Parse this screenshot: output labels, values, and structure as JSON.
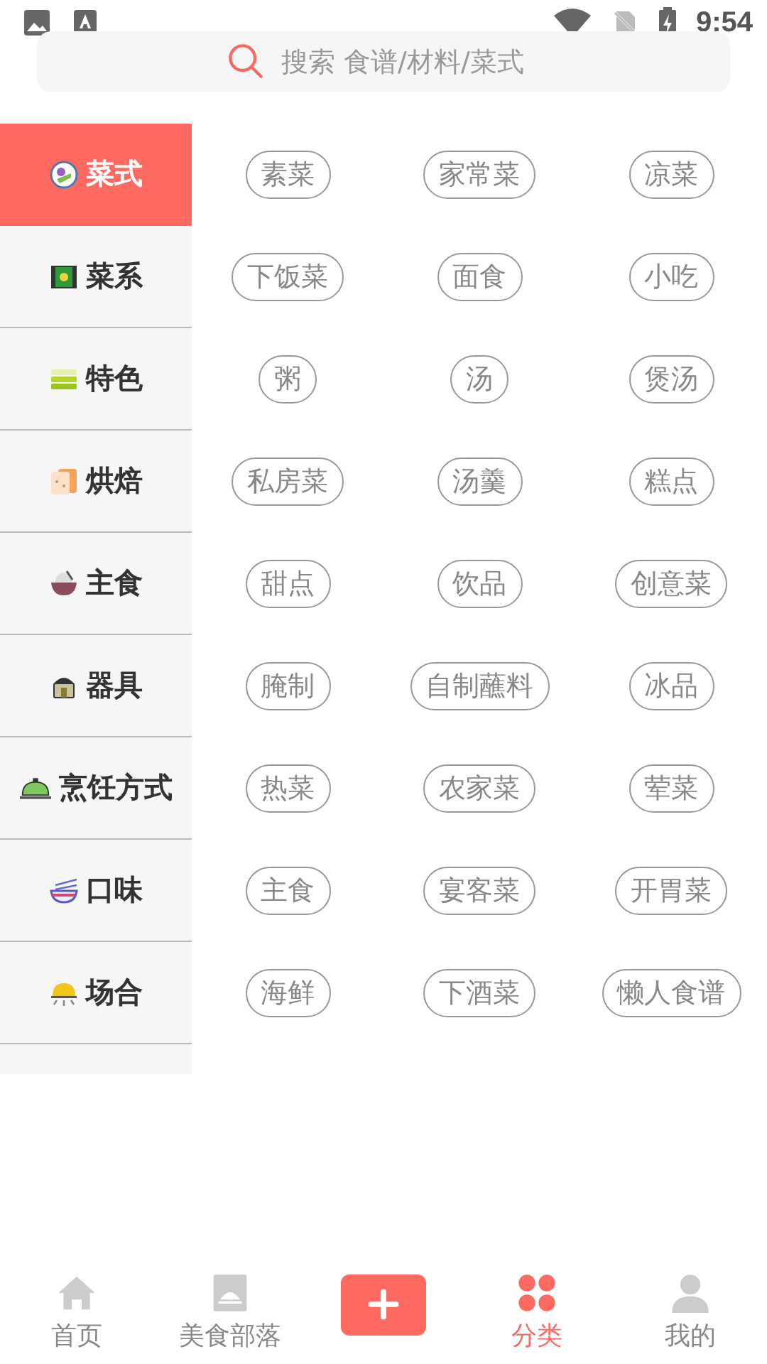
{
  "status_bar": {
    "time": "9:54"
  },
  "search": {
    "placeholder": "搜索 食谱/材料/菜式"
  },
  "categories": [
    {
      "label": "菜式",
      "selected": true
    },
    {
      "label": "菜系",
      "selected": false
    },
    {
      "label": "特色",
      "selected": false
    },
    {
      "label": "烘焙",
      "selected": false
    },
    {
      "label": "主食",
      "selected": false
    },
    {
      "label": "器具",
      "selected": false
    },
    {
      "label": "烹饪方式",
      "selected": false
    },
    {
      "label": "口味",
      "selected": false
    },
    {
      "label": "场合",
      "selected": false
    }
  ],
  "tag_rows": [
    [
      "素菜",
      "家常菜",
      "凉菜"
    ],
    [
      "下饭菜",
      "面食",
      "小吃"
    ],
    [
      "粥",
      "汤",
      "煲汤"
    ],
    [
      "私房菜",
      "汤羹",
      "糕点"
    ],
    [
      "甜点",
      "饮品",
      "创意菜"
    ],
    [
      "腌制",
      "自制蘸料",
      "冰品"
    ],
    [
      "热菜",
      "农家菜",
      "荤菜"
    ],
    [
      "主食",
      "宴客菜",
      "开胃菜"
    ],
    [
      "海鲜",
      "下酒菜",
      "懒人食谱"
    ]
  ],
  "bottom_nav": [
    {
      "kind": "home",
      "label": "首页",
      "selected": false
    },
    {
      "kind": "book",
      "label": "美食部落",
      "selected": false
    },
    {
      "kind": "add"
    },
    {
      "kind": "grid",
      "label": "分类",
      "selected": true
    },
    {
      "kind": "user",
      "label": "我的",
      "selected": false
    }
  ]
}
